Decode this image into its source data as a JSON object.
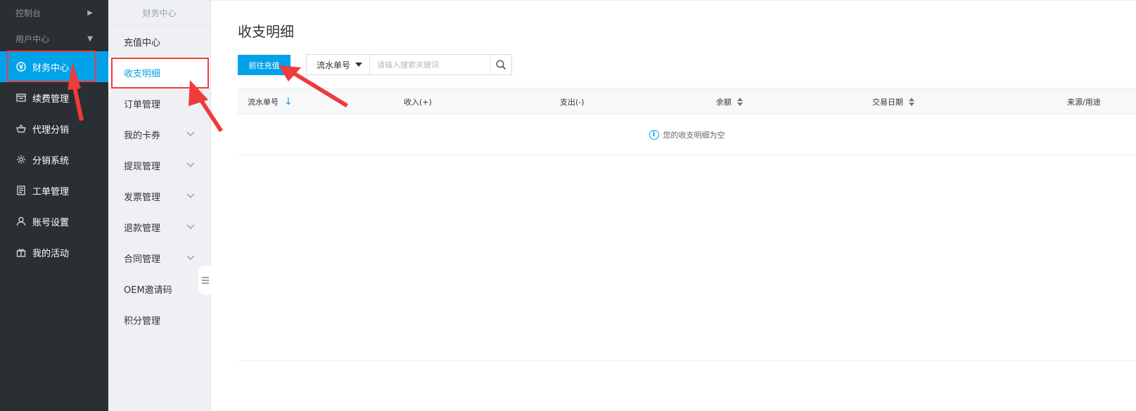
{
  "sidebar": {
    "groups": [
      {
        "label": "控制台"
      },
      {
        "label": "用户中心"
      }
    ],
    "items": [
      {
        "label": "财务中心",
        "icon": "yuan-circle-icon",
        "active": true
      },
      {
        "label": "续费管理",
        "icon": "window-icon"
      },
      {
        "label": "代理分销",
        "icon": "basket-icon"
      },
      {
        "label": "分销系统",
        "icon": "gear-icon"
      },
      {
        "label": "工单管理",
        "icon": "document-icon"
      },
      {
        "label": "账号设置",
        "icon": "user-icon"
      },
      {
        "label": "我的活动",
        "icon": "gift-icon"
      }
    ]
  },
  "subnav": {
    "title": "财务中心",
    "items": [
      {
        "label": "充值中心"
      },
      {
        "label": "收支明细",
        "active": true
      },
      {
        "label": "订单管理"
      },
      {
        "label": "我的卡券",
        "expandable": true
      },
      {
        "label": "提现管理",
        "expandable": true
      },
      {
        "label": "发票管理",
        "expandable": true
      },
      {
        "label": "退款管理",
        "expandable": true
      },
      {
        "label": "合同管理",
        "expandable": true
      },
      {
        "label": "OEM邀请码"
      },
      {
        "label": "积分管理"
      }
    ]
  },
  "main": {
    "title": "收支明细",
    "recharge_button": "前往充值",
    "search": {
      "type_selected": "流水单号",
      "placeholder": "请输入搜索关键词"
    },
    "table": {
      "columns": [
        "流水单号",
        "收入(+)",
        "支出(-)",
        "余额",
        "交易日期",
        "来源/用途"
      ],
      "empty_text": "您的收支明细为空"
    }
  },
  "colors": {
    "accent": "#00a2ea",
    "sidebar_bg": "#2a2f33",
    "annotation": "#ee3b3b"
  }
}
